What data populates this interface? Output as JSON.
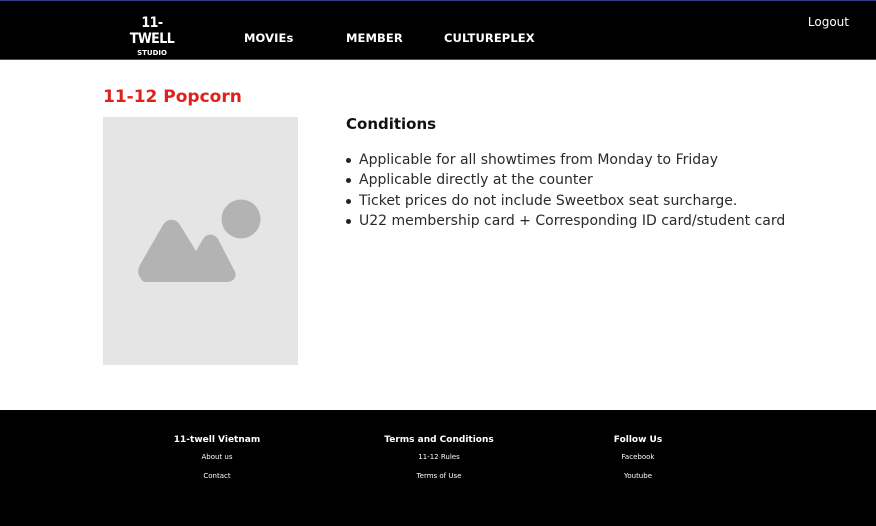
{
  "header": {
    "logo_main": "11-TWELL",
    "logo_sub": "STUDIO",
    "nav": [
      "MOVIEs",
      "MEMBER",
      "CULTUREPLEX"
    ],
    "logout_label": "Logout"
  },
  "main": {
    "product_title": "11-12 Popcorn",
    "image_icon": "image-placeholder-icon",
    "conditions_heading": "Conditions",
    "conditions": [
      "Applicable for all showtimes from Monday to Friday",
      "Applicable directly at the counter",
      "Ticket prices do not include Sweetbox seat surcharge.",
      "U22 membership card + Corresponding ID card/student card"
    ]
  },
  "footer": {
    "columns": [
      {
        "heading": "11-twell Vietnam",
        "links": [
          "About us",
          "Contact"
        ]
      },
      {
        "heading": "Terms and Conditions",
        "links": [
          "11-12 Rules",
          "Terms of Use"
        ]
      },
      {
        "heading": "Follow Us",
        "links": [
          "Facebook",
          "Youtube"
        ]
      }
    ]
  },
  "colors": {
    "header_bg": "#000000",
    "title_red": "#e0201c",
    "placeholder_bg": "#e5e5e5",
    "placeholder_shape": "#b3b3b3",
    "footer_bg": "#000000"
  }
}
